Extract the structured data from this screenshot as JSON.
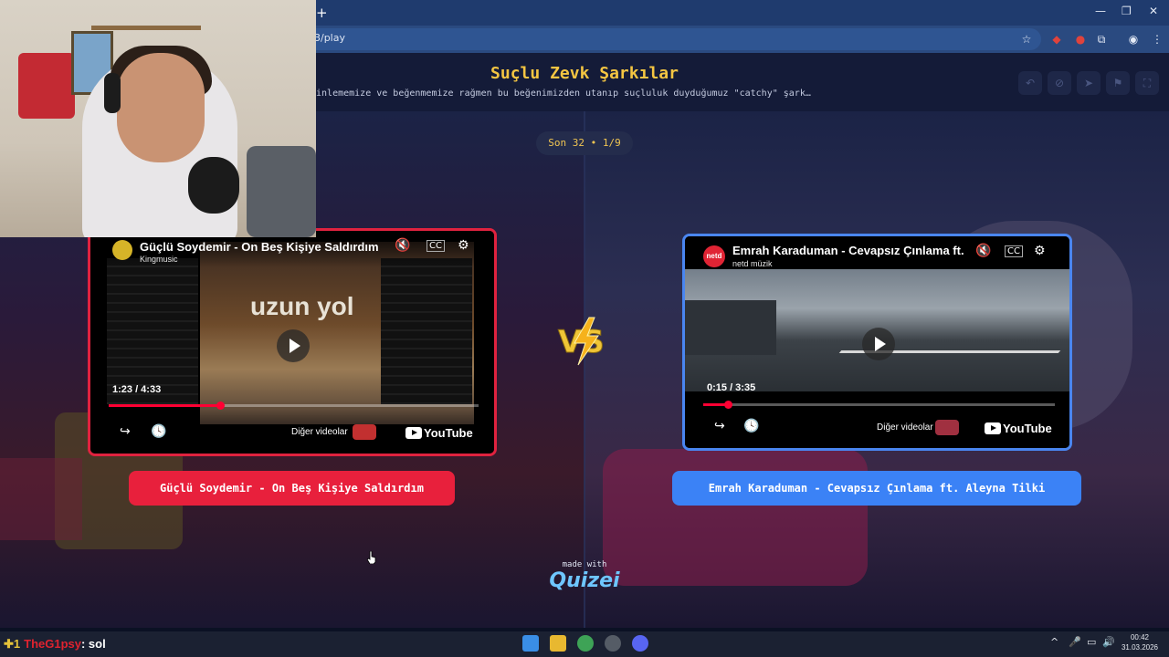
{
  "browser": {
    "new_tab": "+",
    "url": "3/play",
    "min": "—",
    "restore": "❐",
    "close": "✕"
  },
  "header": {
    "title": "Suçlu Zevk Şarkılar",
    "subtitle": "dinlememize ve beğenmemize rağmen bu beğenimizden utanıp suçluluk duyduğumuz \"catchy\" şark…"
  },
  "counter": "Son 32 • 1/9",
  "left": {
    "video_title": "Güçlü Soydemir - On Beş Kişiye Saldırdım",
    "channel": "Kingmusic",
    "time": "1:23 / 4:33",
    "progress": 0.3,
    "more_videos": "Diğer videolar",
    "youtube": "YouTube",
    "choice": "Güçlü Soydemir - On Beş Kişiye Saldırdım",
    "album_text": "uzun yol"
  },
  "right": {
    "video_title": "Emrah Karaduman - Cevapsız Çınlama ft.",
    "channel": "netd müzik",
    "time": "0:15 / 3:35",
    "progress": 0.07,
    "more_videos": "Diğer videolar",
    "youtube": "YouTube",
    "choice": "Emrah Karaduman - Cevapsız Çınlama ft. Aleyna Tilki",
    "logo": "netd"
  },
  "vs": "VS",
  "footer": {
    "made_with": "made with",
    "brand": "Quizei"
  },
  "taskbar": {
    "badge": "✚1",
    "chat_user": "TheG1psy",
    "chat_msg": ": sol",
    "time": "00:42",
    "date": "31.03.2026"
  },
  "colors": {
    "left_accent": "#e8203c",
    "right_accent": "#3b82f6",
    "title": "#f4c542"
  }
}
